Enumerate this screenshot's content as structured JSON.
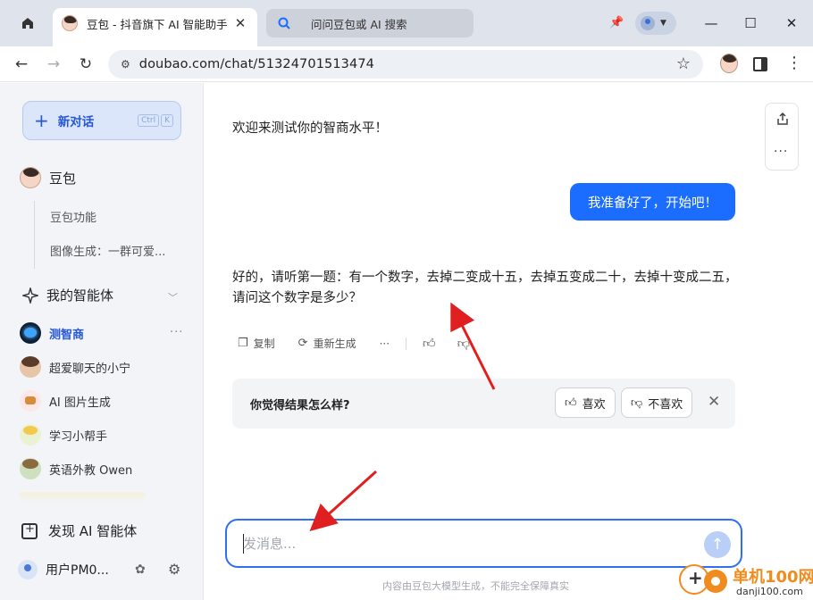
{
  "browser": {
    "tab_title": "豆包 - 抖音旗下 AI 智能助手",
    "search_tab_text": "问问豆包或 AI 搜索",
    "url": "doubao.com/chat/51324701513474"
  },
  "sidebar": {
    "new_chat_label": "新对话",
    "shortcut_keys": [
      "Ctrl",
      "K"
    ],
    "doubao_label": "豆包",
    "doubao_sub_items": [
      "豆包功能",
      "图像生成：一群可爱..."
    ],
    "my_agents_label": "我的智能体",
    "agents": [
      {
        "label": "测智商",
        "active": true
      },
      {
        "label": "超爱聊天的小宁",
        "active": false
      },
      {
        "label": "AI 图片生成",
        "active": false
      },
      {
        "label": "学习小帮手",
        "active": false
      },
      {
        "label": "英语外教 Owen",
        "active": false
      }
    ],
    "discover_label": "发现 AI 智能体",
    "user_name": "用户PM0..."
  },
  "chat": {
    "welcome": "欢迎来测试你的智商水平！",
    "user_message": "我准备好了，开始吧！",
    "bot_message": "好的，请听第一题：有一个数字，去掉二变成十五，去掉五变成二十，去掉十变成二五，请问这个数字是多少？",
    "actions": {
      "copy": "复制",
      "regenerate": "重新生成"
    },
    "feedback": {
      "question": "你觉得结果怎么样?",
      "like": "喜欢",
      "dislike": "不喜欢"
    }
  },
  "input": {
    "placeholder": "发消息...",
    "value": ""
  },
  "footer": {
    "disclaimer": "内容由豆包大模型生成，不能完全保障真实"
  },
  "annotations": {
    "arrow_color": "#e02020"
  },
  "watermark": {
    "title": "单机100网",
    "subtitle": "danji100.com"
  },
  "colors": {
    "accent": "#1a6dff",
    "brand_orange": "#f08c1f"
  }
}
